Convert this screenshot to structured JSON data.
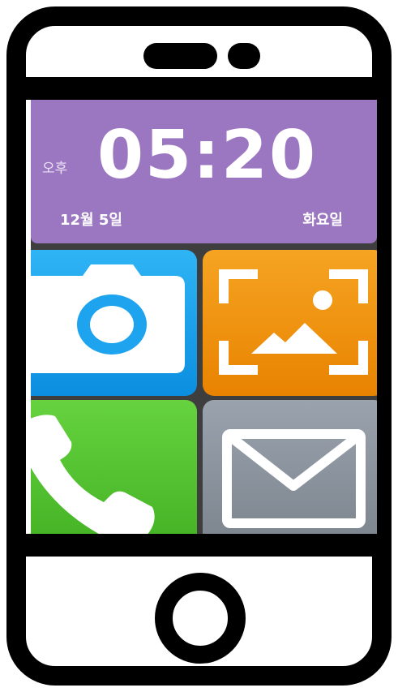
{
  "lock_screen": {
    "ampm": "오후",
    "time": "05:20",
    "date": "12월 5일",
    "weekday": "화요일"
  },
  "apps": [
    {
      "id": "camera",
      "icon": "camera-icon",
      "color": "#1ea3ee"
    },
    {
      "id": "gallery",
      "icon": "gallery-icon",
      "color": "#f29a12"
    },
    {
      "id": "phone",
      "icon": "phone-icon",
      "color": "#55c232"
    },
    {
      "id": "messages",
      "icon": "mail-icon",
      "color": "#8b939d"
    }
  ],
  "colors": {
    "clock_background": "#9c77c1",
    "phone_frame": "#000000"
  }
}
